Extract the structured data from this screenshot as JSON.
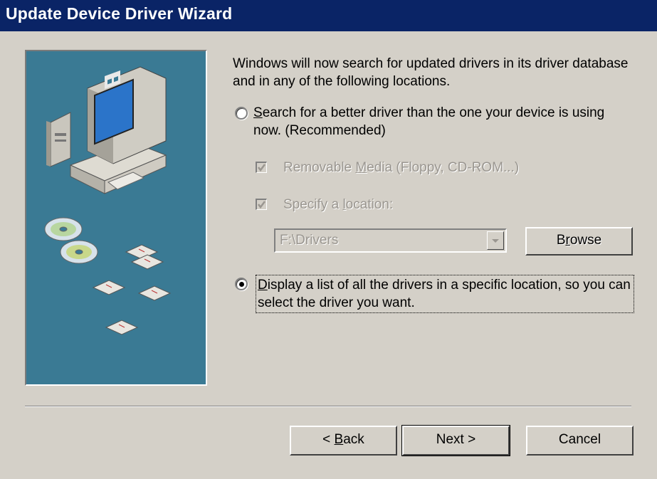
{
  "window": {
    "title": "Update Device Driver Wizard"
  },
  "intro": "Windows will now search for updated drivers in its driver database and in any of the following locations.",
  "options": {
    "search": {
      "accel": "S",
      "rest": "earch for a better driver than the one your device is using now. (Recommended)",
      "selected": false
    },
    "removable": {
      "pre": "Removable ",
      "accel": "M",
      "post": "edia (Floppy, CD-ROM...)",
      "checked": true,
      "enabled": false
    },
    "location": {
      "pre": "Specify a ",
      "accel": "l",
      "post": "ocation:",
      "checked": true,
      "enabled": false,
      "value": "F:\\Drivers"
    },
    "browse": {
      "pre": "B",
      "accel": "r",
      "post": "owse"
    },
    "display": {
      "accel": "D",
      "rest": "isplay a list of all the drivers in a specific location, so you can select the driver you want.",
      "selected": true
    }
  },
  "buttons": {
    "back_pre": "< ",
    "back_accel": "B",
    "back_post": "ack",
    "next": "Next >",
    "cancel": "Cancel"
  },
  "icons": [
    "computer-icon",
    "cd-disc-icon",
    "floppy-disk-icon"
  ],
  "colors": {
    "titlebar": "#0a2466",
    "panel": "#3a7a94",
    "face": "#d4d0c8"
  }
}
